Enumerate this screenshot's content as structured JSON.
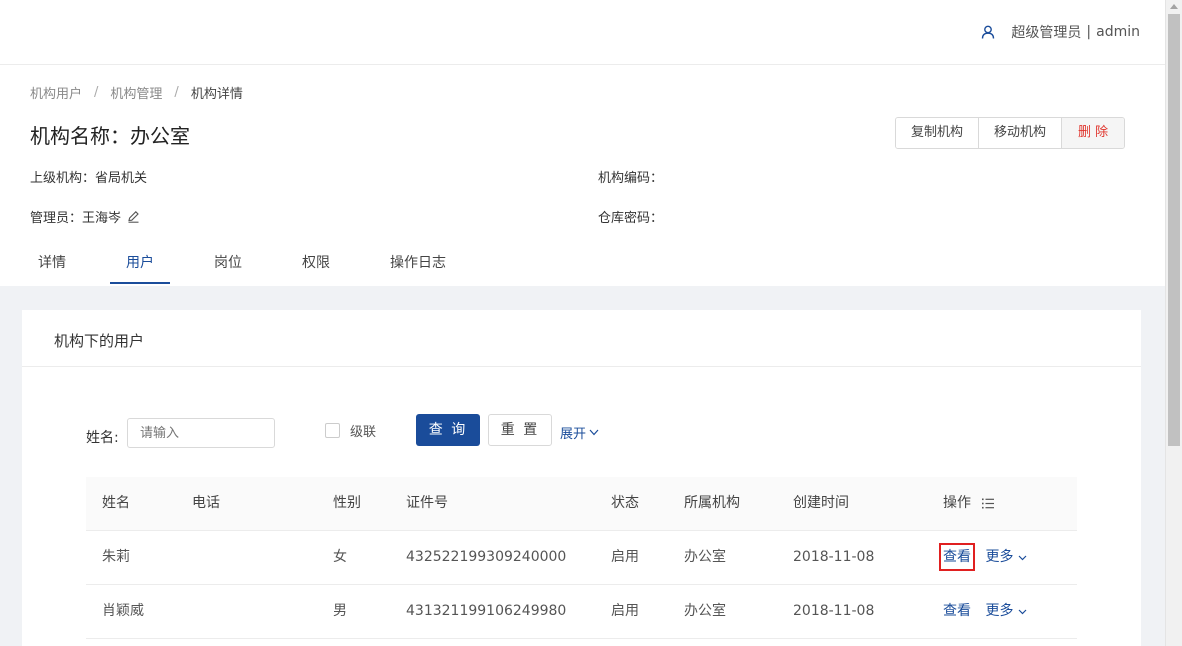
{
  "user": {
    "name": "超级管理员",
    "sep": "|",
    "account": "admin"
  },
  "breadcrumb": [
    "机构用户",
    "机构管理",
    "机构详情"
  ],
  "page_title": "机构名称：办公室",
  "actions": {
    "copy": "复制机构",
    "move": "移动机构",
    "delete": "删 除"
  },
  "info": {
    "parent_label": "上级机构：",
    "parent_value": "省局机关",
    "admin_label": "管理员：",
    "admin_value": "王海岑",
    "code_label": "机构编码：",
    "code_value": "",
    "warehouse_label": "仓库密码：",
    "warehouse_value": ""
  },
  "tabs": [
    "详情",
    "用户",
    "岗位",
    "权限",
    "操作日志"
  ],
  "active_tab": "用户",
  "card": {
    "title": "机构下的用户"
  },
  "filter": {
    "name_label": "姓名:",
    "name_placeholder": "请输入",
    "cascade_label": "级联",
    "search_btn": "查 询",
    "reset_btn": "重 置",
    "expand_label": "展开"
  },
  "table": {
    "columns": [
      "姓名",
      "电话",
      "性别",
      "证件号",
      "状态",
      "所属机构",
      "创建时间",
      "操作"
    ],
    "rows": [
      {
        "name": "朱莉",
        "phone": "",
        "gender": "女",
        "id_no": "432522199309240000",
        "status": "启用",
        "org": "办公室",
        "created": "2018-11-08",
        "view": "查看",
        "more": "更多"
      },
      {
        "name": "肖颖威",
        "phone": "",
        "gender": "男",
        "id_no": "431321199106249980",
        "status": "启用",
        "org": "办公室",
        "created": "2018-11-08",
        "view": "查看",
        "more": "更多"
      }
    ]
  },
  "colors": {
    "primary": "#1a4c9a",
    "danger": "#e0342c",
    "highlight": "#e02020"
  }
}
